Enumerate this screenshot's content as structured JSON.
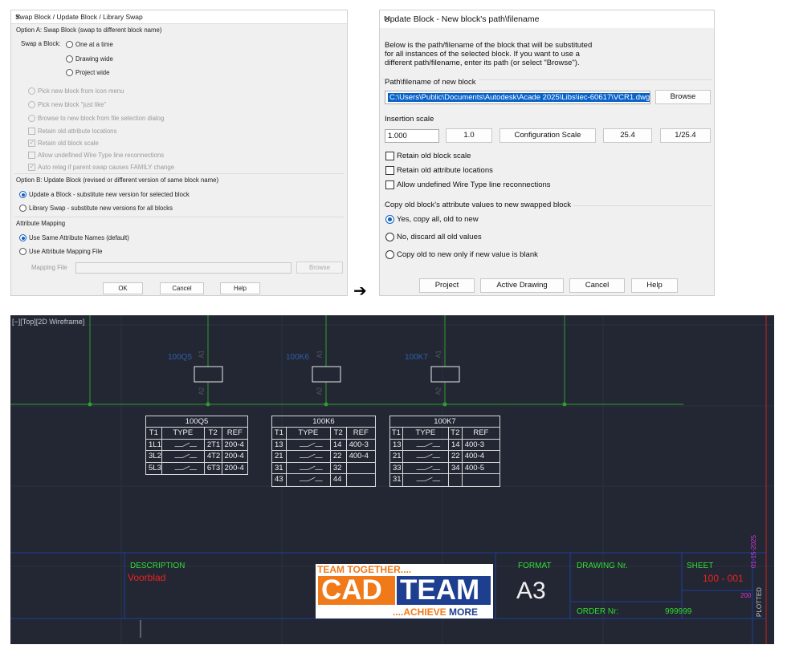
{
  "dialog1": {
    "title": "Swap Block / Update Block / Library Swap",
    "optionA": "Option A: Swap Block (swap to different block name)",
    "swap_label": "Swap a Block:",
    "swap_opts": [
      "One at a time",
      "Drawing wide",
      "Project wide"
    ],
    "pick_opts": [
      "Pick new block from icon menu",
      "Pick new block \"just like\"",
      "Browse to new block from file selection dialog"
    ],
    "check_opts": [
      "Retain old attribute locations",
      "Retain old block scale",
      "Allow undefined Wire Type line reconnections",
      "Auto relag if parent swap causes FAMILY change"
    ],
    "optionB": "Option B: Update Block (revised or different version of same block name)",
    "update_opts": [
      "Update a Block - substitute new version for selected block",
      "Library Swap - substitute new versions for all blocks"
    ],
    "attr_mapping": "Attribute Mapping",
    "mapping_opts": [
      "Use Same Attribute Names (default)",
      "Use Attribute Mapping File"
    ],
    "mapping_file_label": "Mapping File",
    "browse": "Browse",
    "ok": "OK",
    "cancel": "Cancel",
    "help": "Help"
  },
  "arrow": "➔",
  "dialog2": {
    "title": "Update Block - New block's path\\filename",
    "description": [
      "Below is the path/filename of the block that will be substituted",
      "for all instances of the selected block. If you want to use a",
      "different path/filename, enter its path (or select \"Browse\")."
    ],
    "path_label": "Path\\filename of new block",
    "path_value": "C:\\Users\\Public\\Documents\\Autodesk\\Acade 2025\\Libs\\iec-60617\\VCR1.dwg",
    "browse": "Browse",
    "insertion_scale": "Insertion scale",
    "scale_value": "1.000",
    "scale_btns": [
      "1.0",
      "Configuration Scale",
      "25.4",
      "1/25.4"
    ],
    "checks": [
      "Retain old block scale",
      "Retain old attribute locations",
      "Allow undefined Wire Type line reconnections"
    ],
    "copy_label": "Copy old block's attribute values to new swapped block",
    "copy_opts": [
      "Yes, copy all, old to new",
      "No, discard all old values",
      "Copy old to new only if new value is blank"
    ],
    "buttons": [
      "Project",
      "Active Drawing",
      "Cancel",
      "Help"
    ]
  },
  "cad": {
    "viewport_label": "[−][Top][2D Wireframe]",
    "components": [
      {
        "tag": "100Q5",
        "top": "A1",
        "bottom": "A2"
      },
      {
        "tag": "100K6",
        "top": "A1",
        "bottom": "A2"
      },
      {
        "tag": "100K7",
        "top": "A1",
        "bottom": "A2"
      }
    ],
    "tables": [
      {
        "title": "100Q5",
        "headers": [
          "T1",
          "TYPE",
          "T2",
          "REF"
        ],
        "rows": [
          [
            "1L1",
            "",
            "2T1",
            "200-4"
          ],
          [
            "3L2",
            "",
            "4T2",
            "200-4"
          ],
          [
            "5L3",
            "",
            "6T3",
            "200-4"
          ]
        ]
      },
      {
        "title": "100K6",
        "headers": [
          "T1",
          "TYPE",
          "T2",
          "REF"
        ],
        "rows": [
          [
            "13",
            "",
            "14",
            "400-3"
          ],
          [
            "21",
            "",
            "22",
            "400-4"
          ],
          [
            "31",
            "",
            "32",
            ""
          ],
          [
            "43",
            "",
            "44",
            ""
          ]
        ]
      },
      {
        "title": "100K7",
        "headers": [
          "T1",
          "TYPE",
          "T2",
          "REF"
        ],
        "rows": [
          [
            "13",
            "",
            "14",
            "400-3"
          ],
          [
            "21",
            "",
            "22",
            "400-4"
          ],
          [
            "33",
            "",
            "34",
            "400-5"
          ],
          [
            "31",
            "",
            "",
            ""
          ]
        ]
      }
    ],
    "title_block": {
      "description_label": "DESCRIPTION",
      "description_value": "Voorblad",
      "format_label": "FORMAT",
      "format_value": "A3",
      "drawing_label": "DRAWING Nr.",
      "order_label": "ORDER Nr:",
      "order_value": "999999",
      "sheet_label": "SHEET",
      "sheet_value": "100 - 001",
      "sheet_sub": "200",
      "date": "01-15-2025",
      "plotted": "PLOTTED"
    },
    "logo": {
      "top": "TEAM TOGETHER....",
      "left": "CAD",
      "right": "TEAM",
      "bottom_a": "....ACHIEVE",
      "bottom_b": " MORE"
    },
    "colors": {
      "background": "#222733",
      "wire": "#2e9e2e",
      "text_blue": "#2f5fa8",
      "green": "#33dd33",
      "red": "#ee2222",
      "magenta": "#dd33dd",
      "orange": "#f07a1a",
      "navy": "#1e3f8f"
    }
  }
}
